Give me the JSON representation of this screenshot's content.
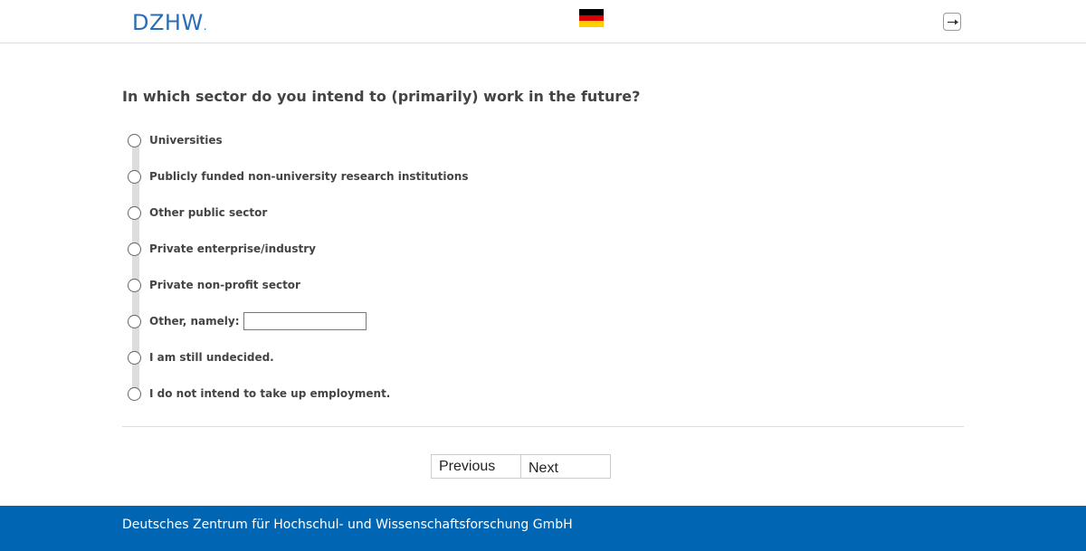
{
  "header": {
    "logo_text": "DZHW",
    "logo_dot": ".",
    "language_flag": "de-flag-icon",
    "flag_colors": [
      "#000000",
      "#dd0000",
      "#ffce00"
    ],
    "logout_icon": "logout-icon"
  },
  "question": {
    "text": "In which sector do you intend to (primarily) work in the future?"
  },
  "options": [
    {
      "label": "Universities"
    },
    {
      "label": "Publicly funded non-university research institutions"
    },
    {
      "label": "Other public sector"
    },
    {
      "label": "Private enterprise/industry"
    },
    {
      "label": "Private non-profit sector"
    },
    {
      "label": "Other, namely:",
      "input_value": "",
      "input_placeholder": ""
    },
    {
      "label": "I am still undecided."
    },
    {
      "label": "I do not intend to take up employment."
    }
  ],
  "navigation": {
    "previous_label": "Previous",
    "next_label": "Next"
  },
  "footer": {
    "text": "Deutsches Zentrum für Hochschul- und Wissenschaftsforschung GmbH",
    "background_color": "#0066b3"
  },
  "colors": {
    "brand_blue": "#2a6db5"
  }
}
